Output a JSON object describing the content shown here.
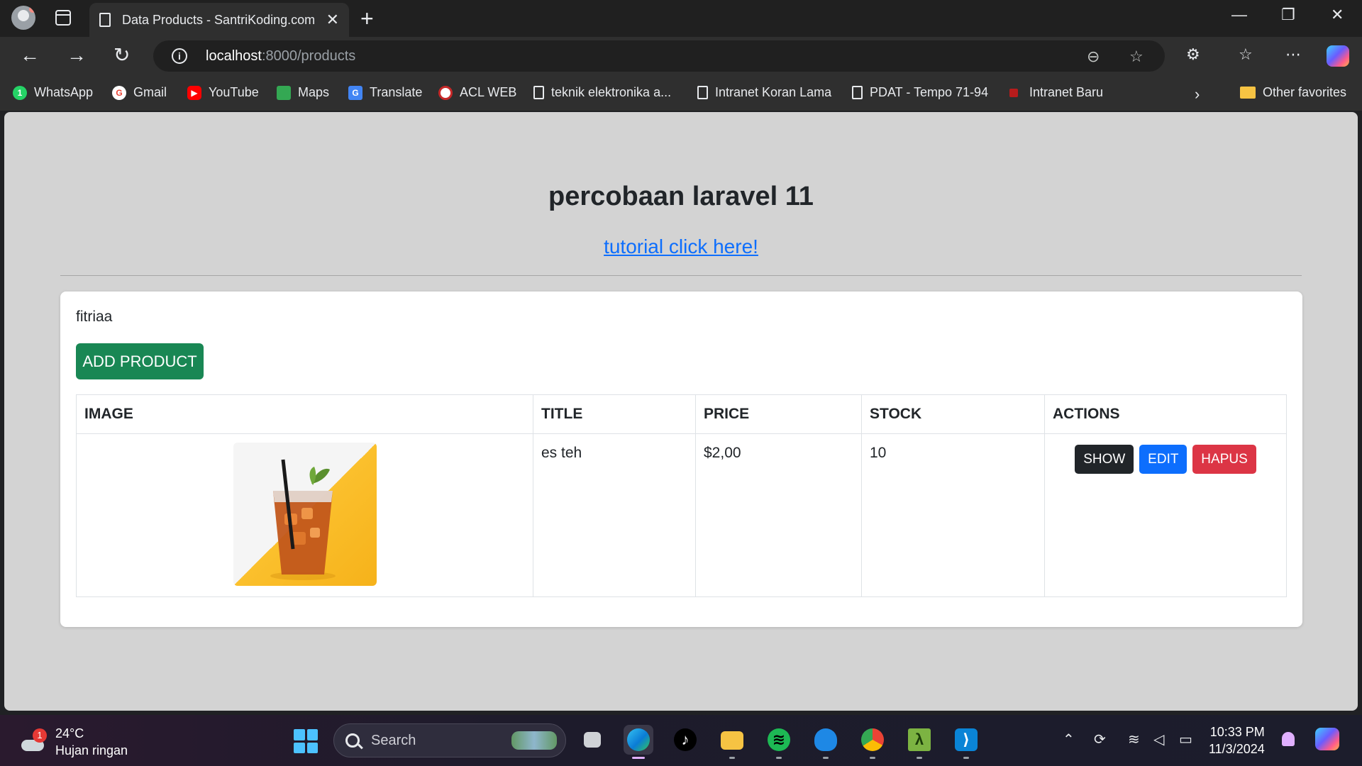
{
  "browser": {
    "tab_title": "Data Products - SantriKoding.com",
    "url_host": "localhost",
    "url_path": ":8000/products",
    "new_tab_glyph": "+",
    "tab_close_glyph": "✕",
    "bookmarks": [
      {
        "label": "WhatsApp",
        "icon": "whatsapp-icon",
        "color": "#25d366"
      },
      {
        "label": "Gmail",
        "icon": "gmail-icon",
        "color": "#ea4335"
      },
      {
        "label": "YouTube",
        "icon": "youtube-icon",
        "color": "#ff0000"
      },
      {
        "label": "Maps",
        "icon": "maps-icon",
        "color": "#34a853"
      },
      {
        "label": "Translate",
        "icon": "translate-icon",
        "color": "#4285f4"
      },
      {
        "label": "ACL WEB",
        "icon": "acl-icon",
        "color": "#c62828"
      },
      {
        "label": "teknik elektronika a...",
        "icon": "page-icon"
      },
      {
        "label": "Intranet Koran Lama",
        "icon": "page-icon"
      },
      {
        "label": "PDAT - Tempo 71-94",
        "icon": "page-icon"
      },
      {
        "label": "Intranet Baru",
        "icon": "intranet-icon",
        "color": "#b71c1c"
      }
    ],
    "other_favorites": "Other favorites"
  },
  "page": {
    "title": "percobaan laravel 11",
    "tutorial_link": "tutorial click here!",
    "user_name": "fitriaa",
    "add_button": "ADD PRODUCT",
    "table": {
      "headers": [
        "IMAGE",
        "TITLE",
        "PRICE",
        "STOCK",
        "ACTIONS"
      ],
      "rows": [
        {
          "title": "es teh",
          "price": "$2,00",
          "stock": "10",
          "image": "iced-tea-image"
        }
      ]
    },
    "actions": {
      "show": "SHOW",
      "edit": "EDIT",
      "delete": "HAPUS"
    }
  },
  "taskbar": {
    "weather_temp": "24°C",
    "weather_desc": "Hujan ringan",
    "weather_badge": "1",
    "search_label": "Search",
    "time": "10:33 PM",
    "date": "11/3/2024"
  },
  "colors": {
    "success": "#198754",
    "primary": "#0d6efd",
    "danger": "#dc3545",
    "dark": "#212529",
    "page_bg": "#d3d3d3"
  }
}
